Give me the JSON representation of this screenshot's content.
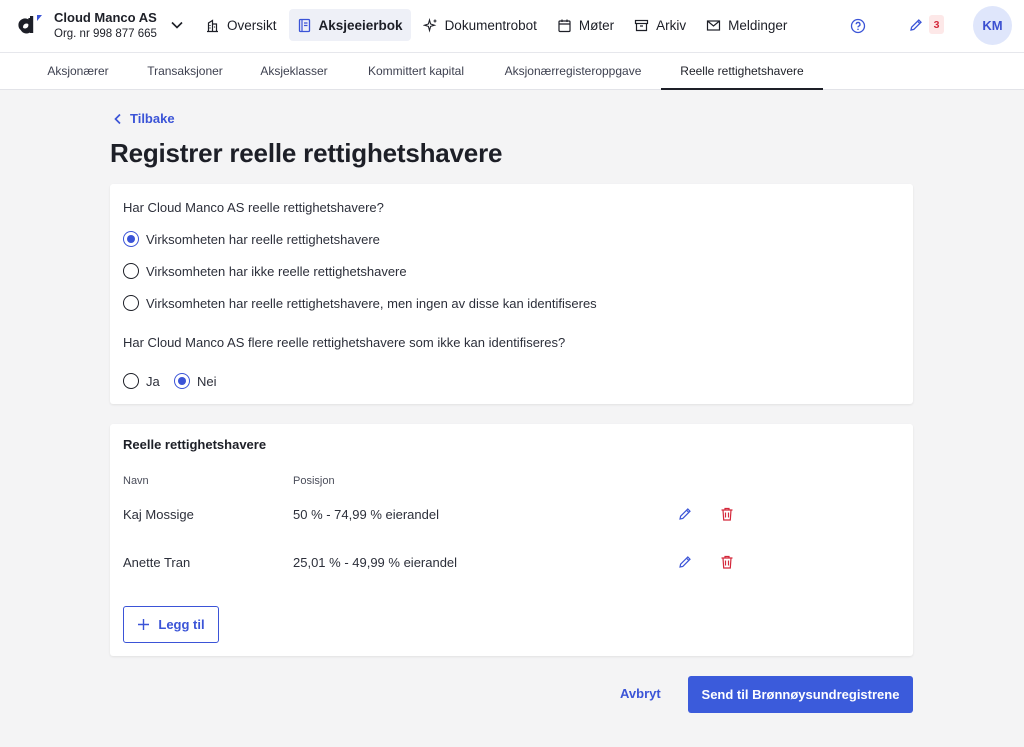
{
  "header": {
    "company_name": "Cloud Manco AS",
    "org_number": "Org. nr 998 877 665",
    "nav": [
      {
        "label": "Oversikt",
        "icon": "building-icon"
      },
      {
        "label": "Aksjeeierbok",
        "icon": "book-icon",
        "active": true
      },
      {
        "label": "Dokumentrobot",
        "icon": "sparkle-icon"
      },
      {
        "label": "Møter",
        "icon": "calendar-icon"
      },
      {
        "label": "Arkiv",
        "icon": "archive-icon"
      },
      {
        "label": "Meldinger",
        "icon": "mail-icon"
      }
    ],
    "badge_count": "3",
    "avatar_initials": "KM"
  },
  "subnav": {
    "tabs": [
      {
        "label": "Aksjonærer"
      },
      {
        "label": "Transaksjoner"
      },
      {
        "label": "Aksjeklasser"
      },
      {
        "label": "Kommittert kapital"
      },
      {
        "label": "Aksjonærregisteroppgave"
      },
      {
        "label": "Reelle rettighetshavere",
        "active": true
      }
    ]
  },
  "page": {
    "back_label": "Tilbake",
    "title": "Registrer reelle rettighetshavere"
  },
  "question1": {
    "text": "Har Cloud Manco AS reelle rettighetshavere?",
    "options": [
      {
        "label": "Virksomheten har reelle rettighetshavere",
        "checked": true
      },
      {
        "label": "Virksomheten har ikke reelle rettighetshavere",
        "checked": false
      },
      {
        "label": "Virksomheten har reelle rettighetshavere, men ingen av disse kan identifiseres",
        "checked": false
      }
    ]
  },
  "question2": {
    "text": "Har Cloud Manco AS flere reelle rettighetshavere som ikke kan identifiseres?",
    "options": [
      {
        "label": "Ja",
        "checked": false
      },
      {
        "label": "Nei",
        "checked": true
      }
    ]
  },
  "owners": {
    "title": "Reelle rettighetshavere",
    "columns": {
      "name": "Navn",
      "position": "Posisjon"
    },
    "rows": [
      {
        "name": "Kaj Mossige",
        "position": "50 % - 74,99 % eierandel"
      },
      {
        "name": "Anette Tran",
        "position": "25,01 % - 49,99 % eierandel"
      }
    ],
    "add_label": "Legg til"
  },
  "footer": {
    "cancel_label": "Avbryt",
    "submit_label": "Send til Brønnøysundregistrene"
  },
  "colors": {
    "accent": "#3b54d7",
    "danger": "#d4283b",
    "background": "#f4f4f5"
  }
}
